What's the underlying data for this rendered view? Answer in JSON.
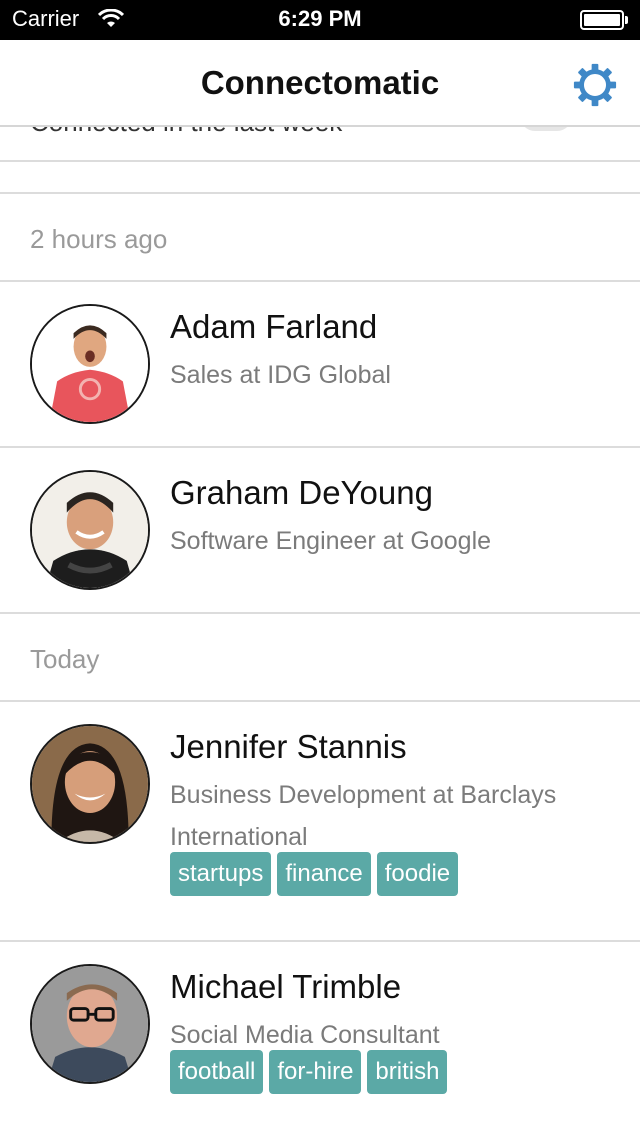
{
  "status_bar": {
    "carrier": "Carrier",
    "time": "6:29 PM"
  },
  "nav": {
    "title": "Connectomatic",
    "settings_icon": "gear-icon",
    "accent_color": "#3f88c7"
  },
  "filter": {
    "label": "Connected in the last week"
  },
  "sections": [
    {
      "label": "2 hours ago",
      "people": [
        {
          "name": "Adam Farland",
          "title": "Sales at IDG Global",
          "tags": []
        },
        {
          "name": "Graham DeYoung",
          "title": "Software Engineer at Google",
          "tags": []
        }
      ]
    },
    {
      "label": "Today",
      "people": [
        {
          "name": "Jennifer Stannis",
          "title": "Business Development at Barclays International",
          "tags": [
            "startups",
            "finance",
            "foodie"
          ]
        },
        {
          "name": "Michael Trimble",
          "title": "Social Media Consultant",
          "tags": [
            "football",
            "for-hire",
            "british"
          ]
        }
      ]
    }
  ],
  "colors": {
    "tag_background": "#5ba9a6",
    "separator": "#dcdcdc",
    "secondary_text": "#7b7b7b"
  }
}
